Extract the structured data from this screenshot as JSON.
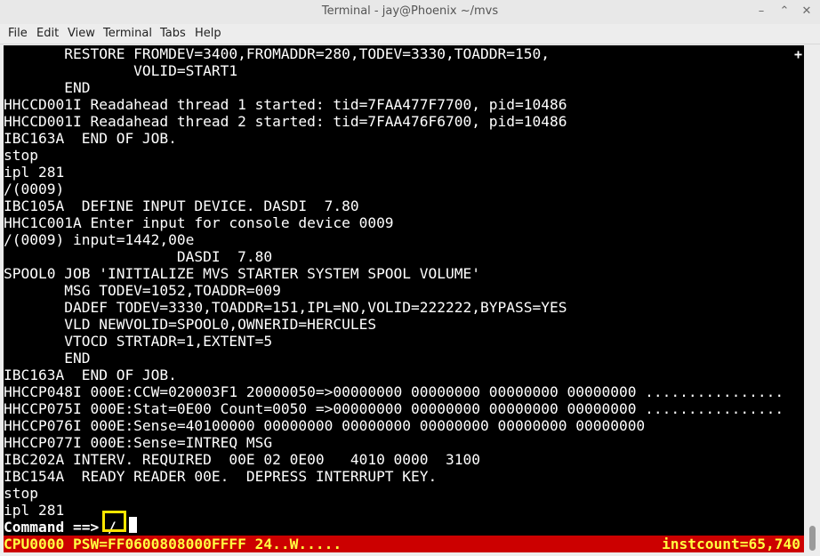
{
  "window": {
    "title": "Terminal - jay@Phoenix ~/mvs",
    "icons": {
      "minimize": "minimize-icon",
      "maximize": "maximize-icon",
      "close": "close-icon"
    }
  },
  "menu": [
    "File",
    "Edit",
    "View",
    "Terminal",
    "Tabs",
    "Help"
  ],
  "terminal": {
    "marker": "+",
    "lines": [
      "       RESTORE FROMDEV=3400,FROMADDR=280,TODEV=3330,TOADDR=150,",
      "               VOLID=START1",
      "       END",
      "HHCCD001I Readahead thread 1 started: tid=7FAA477F7700, pid=10486",
      "HHCCD001I Readahead thread 2 started: tid=7FAA476F6700, pid=10486",
      "IBC163A  END OF JOB.",
      "stop",
      "ipl 281",
      "/(0009)",
      "IBC105A  DEFINE INPUT DEVICE. DASDI  7.80",
      "HHC1C001A Enter input for console device 0009",
      "/(0009) input=1442,00e",
      "                    DASDI  7.80",
      "SPOOL0 JOB 'INITIALIZE MVS STARTER SYSTEM SPOOL VOLUME'",
      "       MSG TODEV=1052,TOADDR=009",
      "       DADEF TODEV=3330,TOADDR=151,IPL=NO,VOLID=222222,BYPASS=YES",
      "       VLD NEWVOLID=SPOOL0,OWNERID=HERCULES",
      "       VTOCD STRTADR=1,EXTENT=5",
      "       END",
      "IBC163A  END OF JOB.",
      "HHCCP048I 000E:CCW=020003F1 20000050=>00000000 00000000 00000000 00000000 ................",
      "HHCCP075I 000E:Stat=0E00 Count=0050 =>00000000 00000000 00000000 00000000 ................",
      "HHCCP076I 000E:Sense=40100000 00000000 00000000 00000000 00000000 00000000",
      "HHCCP077I 000E:Sense=INTREQ MSG",
      "IBC202A INTERV. REQUIRED  00E 02 0E00   4010 0000  3100",
      "IBC154A  READY READER 00E.  DEPRESS INTERRUPT KEY.",
      "stop",
      "ipl 281"
    ],
    "command_prompt": "Command ==> ",
    "command_input": "/"
  },
  "statusbar": {
    "left": "CPU0000 PSW=FF0600808000FFFF 24..W.....",
    "right": "instcount=65,740"
  },
  "colors": {
    "terminal_bg": "#000000",
    "terminal_fg": "#ffffff",
    "status_bg": "#cc0000",
    "status_fg": "#ffff40",
    "highlight": "#ffe600"
  }
}
